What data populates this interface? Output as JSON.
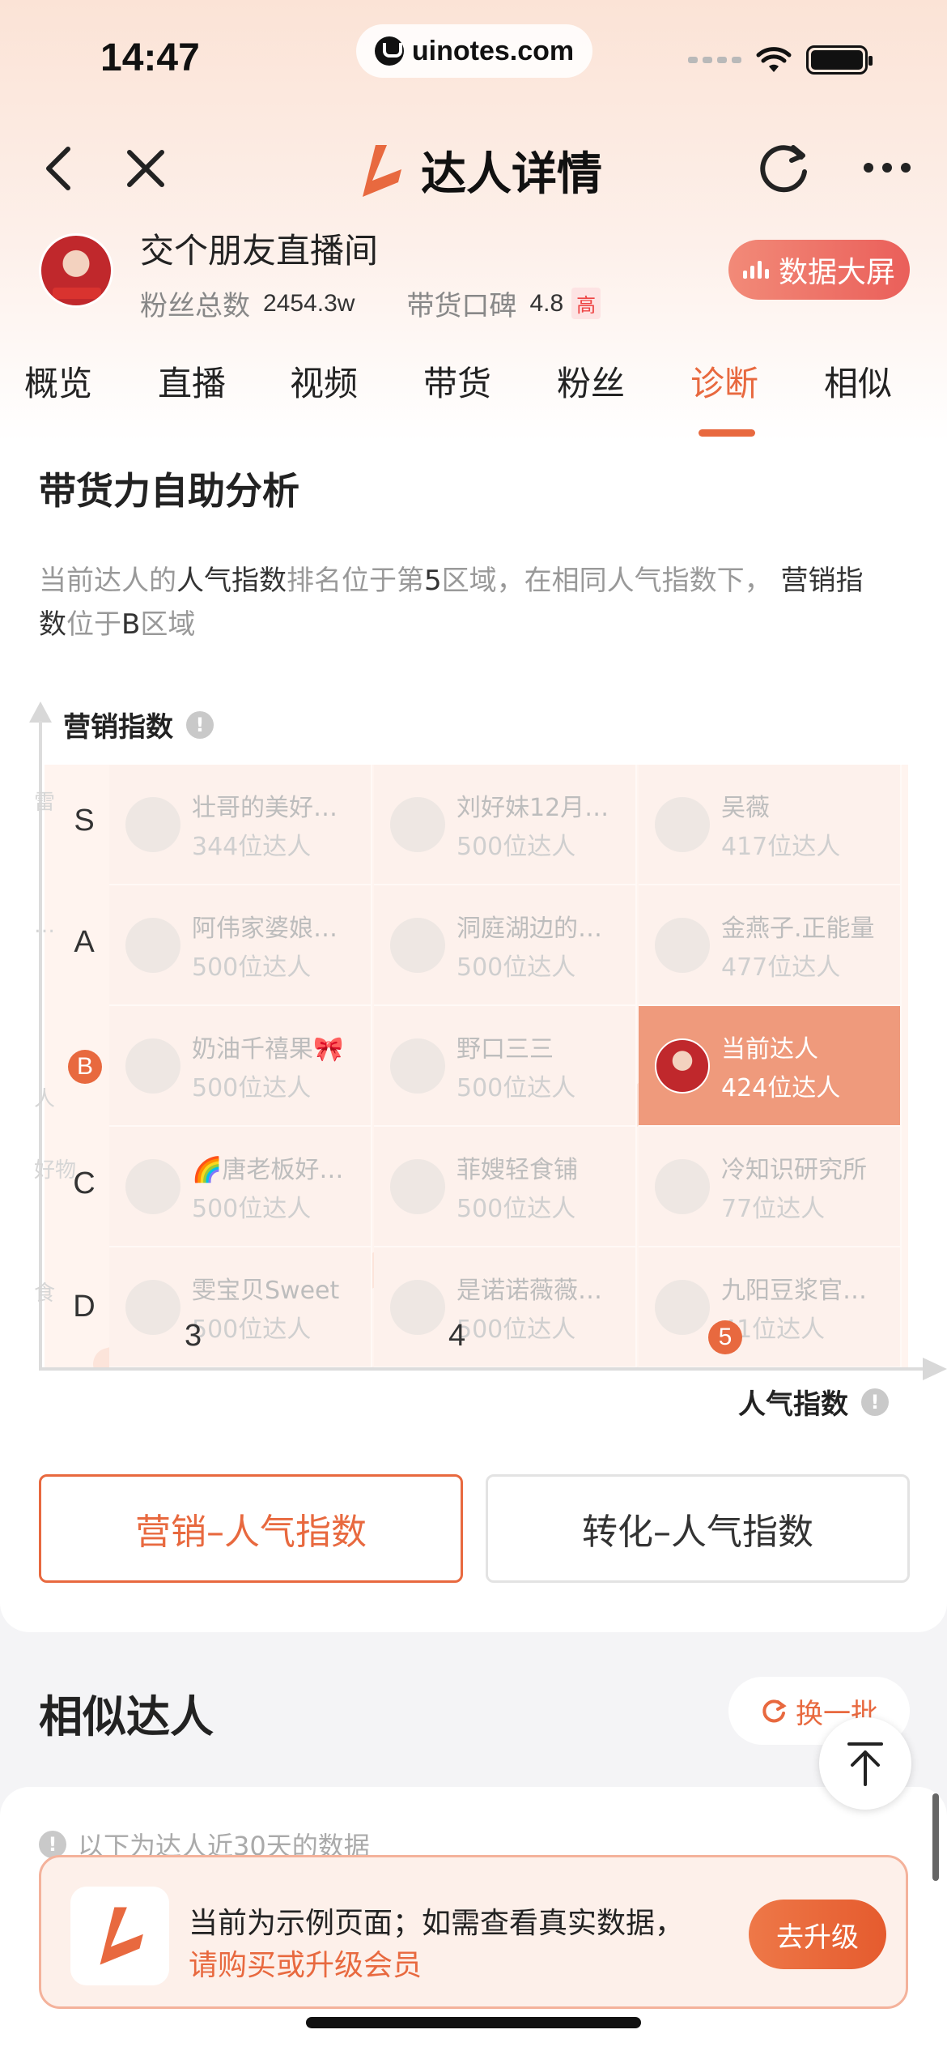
{
  "status_bar": {
    "time": "14:47",
    "url": "uinotes.com"
  },
  "nav": {
    "title": "达人详情"
  },
  "profile": {
    "name": "交个朋友直播间",
    "fans_label": "粉丝总数",
    "fans_value": "2454.3w",
    "reputation_label": "带货口碑",
    "reputation_value": "4.8",
    "reputation_badge": "高",
    "data_screen_label": "数据大屏"
  },
  "tabs": [
    "概览",
    "直播",
    "视频",
    "带货",
    "粉丝",
    "诊断",
    "相似"
  ],
  "active_tab": "诊断",
  "analysis": {
    "title": "带货力自助分析",
    "desc_parts": [
      "当前达人的",
      "人气指数",
      "排名位于第",
      "5",
      "区域，在相同人气指数下，",
      "营销指数",
      "位于",
      "B",
      "区域"
    ],
    "y_axis_label": "营销指数",
    "x_axis_label": "人气指数",
    "row_labels": [
      "S",
      "A",
      "B",
      "C",
      "D"
    ],
    "col_labels": [
      "3",
      "4",
      "5"
    ],
    "highlight_row": "B",
    "highlight_col": "5",
    "edge_fragments": [
      "雷",
      "…",
      "人",
      "好物",
      "食"
    ],
    "rows": [
      [
        {
          "name": "壮哥的美好…",
          "count": "344位达人"
        },
        {
          "name": "刘好妹12月…",
          "count": "500位达人"
        },
        {
          "name": "吴薇",
          "count": "417位达人"
        }
      ],
      [
        {
          "name": "阿伟家婆娘…",
          "count": "500位达人"
        },
        {
          "name": "洞庭湖边的…",
          "count": "500位达人"
        },
        {
          "name": "金燕子.正能量",
          "count": "477位达人"
        }
      ],
      [
        {
          "name": "奶油千禧果🎀",
          "count": "500位达人"
        },
        {
          "name": "野口三三",
          "count": "500位达人"
        },
        {
          "name": "当前达人",
          "count": "424位达人",
          "current": true
        }
      ],
      [
        {
          "name": "🌈唐老板好…",
          "count": "500位达人"
        },
        {
          "name": "菲嫂轻食铺",
          "count": "500位达人"
        },
        {
          "name": "冷知识研究所",
          "count": "77位达人"
        }
      ],
      [
        {
          "name": "雯宝贝Sweet",
          "count": "500位达人"
        },
        {
          "name": "是诺诺薇薇…",
          "count": "500位达人"
        },
        {
          "name": "九阳豆浆官…",
          "count": "41位达人"
        }
      ]
    ],
    "toggle_active": "营销–人气指数",
    "toggle_inactive": "转化–人气指数"
  },
  "similar": {
    "title": "相似达人",
    "swap_label": "换一批",
    "note": "以下为达人近30天的数据"
  },
  "upsell": {
    "line1": "当前为示例页面；如需查看真实数据，",
    "line2": "请购买或升级会员",
    "button": "去升级"
  },
  "colors": {
    "accent": "#e8693f",
    "highlight_cell": "#ef9a7c",
    "badge_high": "#ee4444"
  }
}
